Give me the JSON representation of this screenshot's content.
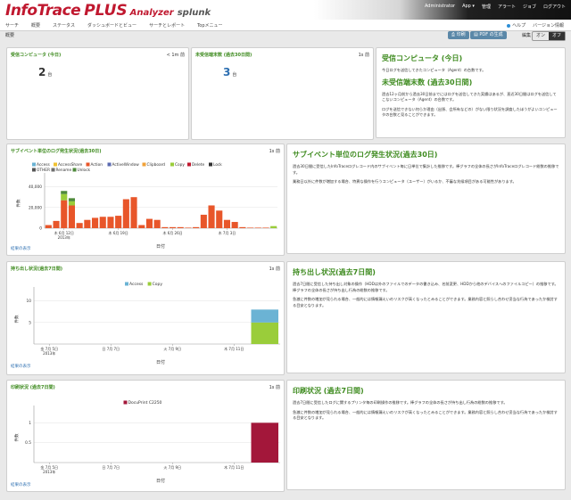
{
  "header": {
    "logo_brand": "InfoTrace",
    "logo_plus": "PLUS",
    "logo_analyzer": "Analyzer",
    "logo_splunk": "splunk",
    "user": "Administrator",
    "nav": [
      "App ▾",
      "管理",
      "アラート",
      "ジョブ",
      "ログアウト"
    ]
  },
  "subnav": {
    "links": [
      "サーチ",
      "概要",
      "ステータス",
      "ダッシュボードとビュー",
      "サーチとレポート",
      "Topメニュー"
    ],
    "help": "ヘルプ",
    "version": "バージョン情報"
  },
  "toolbar": {
    "breadcrumb": "概要",
    "print": "印刷",
    "pdf": "PDF の生成",
    "edit_label": "編集：",
    "edit_on": "オン",
    "edit_off": "オフ"
  },
  "panels": {
    "received": {
      "title": "受信コンピュータ (今日)",
      "badge": "< 1m 前",
      "value": "2",
      "unit": "台"
    },
    "unreceived": {
      "title": "未受信端末数 (過去30日間)",
      "badge": "1s 前",
      "value": "3",
      "unit": "台"
    },
    "info1": {
      "h1": "受信コンピュータ (今日)",
      "p1": "今日ログを送信してきたコンピュータ（Agent）の台数です。",
      "h2": "未受信端末数 (過去30日間)",
      "p2": "過去12ヶ月前から過去30日前までにはログを送信してきた実績はあるが、直近30日間はログを送信してこないコンピュータ（Agent）の台数です。",
      "p3": "ログを送信できない何らか理由（出張、会所有などの）がない限り状況を調査したほうがよいコンピュータの台数と見ることができます。"
    },
    "subevent": {
      "title": "サブイベント単位のログ発生状況(過去30日)",
      "badge": "1s 前",
      "more": "結果の表示",
      "info_h": "サブイベント単位のログ発生状況(過去30日)",
      "info_p1": "過去30日間に受信したInfoTraceログレコード内のサブイベント毎に日単位で集計した推移です。棒グラフの全体の長さがInfoTraceログレコード総数の推移です。",
      "info_p2": "業務日以外に件数が増加する場合、特異な操作を行うコンピュータ（ユーザー）がいるか、不審な兆候項目がある可能性があります。"
    },
    "takeout": {
      "title": "持ち出し状況(過去7日間)",
      "badge": "1s 前",
      "more": "結果の表示",
      "info_h": "持ち出し状況(過去7日間)",
      "info_p1": "過去7日間に受信した持ち出し対象の操作（HDDは外のファイルでのデータの書き込み、名前変更、HDDから他のデバイスへのファイルコピー）の推移です。棒グラフの全体の長さが持ち出し行為の総数の推移です。",
      "info_p2": "急激に件数の増加が見られる場合、一般的には情報漏えいのリスクが高くなったとみることができます。業務内容と照らし合わせ妥当な行為であったか検討する目安となります。"
    },
    "print_panel": {
      "title": "印刷状況 (過去7日間)",
      "badge": "1s 前",
      "more": "結果の表示",
      "info_h": "印刷状況 (過去7日間)",
      "info_p1": "過去7日間に受信したログに関するプリンタ毎の印刷操作の推移です。棒グラフの全体の長さが持ち出し行為の総数の推移です。",
      "info_p2": "急激に件数の増加が見られる場合、一般的には情報漏えいのリスクが高くなったとみることができます。業務内容と照らし合わせ妥当な行為であったか検討する目安となります。"
    }
  },
  "chart_data": [
    {
      "type": "bar",
      "title": "",
      "xlabel": "日付",
      "ylabel": "件数",
      "ylim": [
        0,
        50000
      ],
      "yticks": [
        "0",
        "20,000",
        "40,000"
      ],
      "xticklabels": [
        "木 6月 12日\n2013年",
        "木 6月 19日",
        "木 6月 26日",
        "木 7月 3日"
      ],
      "legend": [
        "Access",
        "AccessShare",
        "Action",
        "ActiveWindow",
        "Clipboard",
        "Copy",
        "Delete",
        "Lock",
        "OTHER",
        "Rename",
        "Unlock"
      ],
      "colors": {
        "Access": "#6bb3d4",
        "AccessShare": "#f1c232",
        "Action": "#e8562a",
        "ActiveWindow": "#5b6ab0",
        "Clipboard": "#f0a239",
        "Copy": "#9acd3a",
        "Delete": "#c0182f",
        "Lock": "#333333",
        "OTHER": "#555555",
        "Rename": "#6e6e6e",
        "Unlock": "#4e8a3b"
      },
      "stacks": [
        {
          "Action": 3000
        },
        {
          "Action": 7000
        },
        {
          "Action": 27000,
          "Copy": 6000,
          "Unlock": 3000
        },
        {
          "Action": 22000,
          "Copy": 4000,
          "Unlock": 3000
        },
        {
          "Action": 5000
        },
        {
          "Action": 8000
        },
        {
          "Action": 10000
        },
        {
          "Action": 11000
        },
        {
          "Action": 11000
        },
        {
          "Action": 12000
        },
        {
          "Action": 28000
        },
        {
          "Action": 30000
        },
        {
          "Action": 3000
        },
        {
          "Action": 9000
        },
        {
          "Action": 8000
        },
        {
          "Action": 1000
        },
        {
          "Action": 1000
        },
        {
          "Action": 1000
        },
        {
          "Action": 500
        },
        {
          "Action": 1000
        },
        {
          "Action": 13000
        },
        {
          "Action": 22000
        },
        {
          "Action": 17000
        },
        {
          "Action": 8000
        },
        {
          "Action": 6000
        },
        {
          "Action": 1000
        },
        {
          "Action": 500
        },
        {
          "Action": 500
        },
        {
          "Action": 500
        },
        {
          "Copy": 2000
        }
      ]
    },
    {
      "type": "bar",
      "title": "",
      "xlabel": "日付",
      "ylabel": "件数",
      "ylim": [
        0,
        12
      ],
      "yticks": [
        "5",
        "10"
      ],
      "xticklabels": [
        "金 7月 5日\n2013年",
        "日 7月 7日",
        "火 7月 9日",
        "木 7月 11日"
      ],
      "series": [
        {
          "name": "Access",
          "color": "#6bb3d4",
          "values": [
            0,
            0,
            0,
            0,
            0,
            0,
            0,
            3
          ]
        },
        {
          "name": "Copy",
          "color": "#9acd3a",
          "values": [
            0,
            0,
            0,
            0,
            0,
            0,
            0,
            5
          ]
        }
      ]
    },
    {
      "type": "bar",
      "title": "",
      "xlabel": "日付",
      "ylabel": "件数",
      "ylim": [
        0,
        1.3
      ],
      "yticks": [
        "0.5",
        "1"
      ],
      "xticklabels": [
        "金 7月 5日\n2013年",
        "日 7月 7日",
        "火 7月 9日",
        "木 7月 11日"
      ],
      "series": [
        {
          "name": "DocuPrint C2250",
          "color": "#a3173a",
          "values": [
            0,
            0,
            0,
            0,
            0,
            0,
            0,
            1
          ]
        }
      ]
    }
  ]
}
